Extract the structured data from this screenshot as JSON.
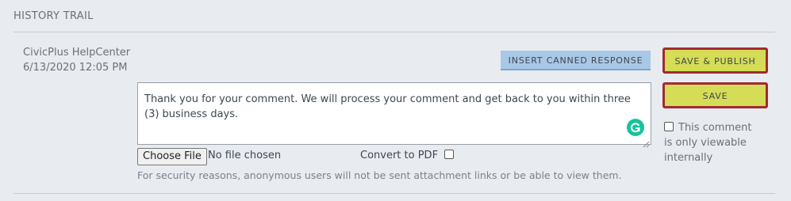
{
  "section": {
    "title": "HISTORY TRAIL"
  },
  "entry": {
    "author": "CivicPlus HelpCenter",
    "datetime": "6/13/2020 12:05 PM"
  },
  "buttons": {
    "insert_canned": "INSERT CANNED RESPONSE",
    "save_publish": "SAVE & PUBLISH",
    "save": "SAVE"
  },
  "comment": {
    "text": "Thank you for your comment. We will process your comment and get back to you within three (3) business days."
  },
  "attachment": {
    "choose_file_label": "Choose File",
    "file_status": "No file chosen",
    "convert_pdf_label": "Convert to PDF",
    "convert_pdf_checked": false
  },
  "internal_option": {
    "label": "This comment is only viewable internally",
    "checked": false
  },
  "security_note": "For security reasons, anonymous users will not be sent attachment links or be able to view them.",
  "colors": {
    "background": "#e8ebf0",
    "canned_button": "#a9c8e6",
    "save_button": "#d5dc55",
    "highlight_border": "#a12a33",
    "grammarly": "#15c39a"
  },
  "icons": {
    "grammarly": "grammarly-icon",
    "resize": "resize-grip-icon"
  }
}
